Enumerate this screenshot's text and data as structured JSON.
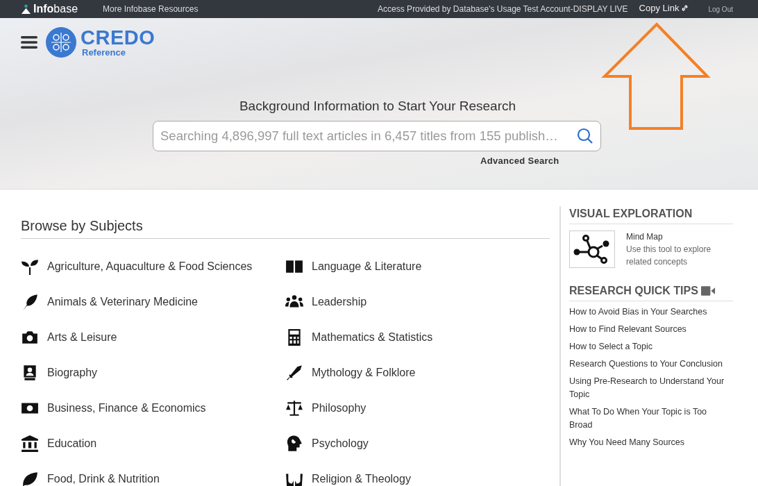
{
  "top_bar": {
    "brand": "**Info**base",
    "resources_link": "More Infobase Resources",
    "access_text": "Access Provided by Database's Usage Test Account-DISPLAY LIVE",
    "copy_link": "Copy Link",
    "logout": "Log Out"
  },
  "header": {
    "logo_title": "CREDO",
    "logo_subtitle": "Reference"
  },
  "hero": {
    "heading": "Background Information to Start Your Research",
    "search": {
      "placeholder": "Searching 4,896,997 full text articles in 6,457 titles from 155 publish…"
    },
    "advanced_search": "Advanced Search"
  },
  "browse": {
    "title": "Browse by Subjects",
    "subjects": [
      {
        "label": "Agriculture, Aquaculture & Food Sciences"
      },
      {
        "label": "Animals & Veterinary Medicine"
      },
      {
        "label": "Arts & Leisure"
      },
      {
        "label": "Biography"
      },
      {
        "label": "Business, Finance & Economics"
      },
      {
        "label": "Education"
      },
      {
        "label": "Food, Drink & Nutrition"
      },
      {
        "label": "Language & Literature"
      },
      {
        "label": "Leadership"
      },
      {
        "label": "Mathematics & Statistics"
      },
      {
        "label": "Mythology & Folklore"
      },
      {
        "label": "Philosophy"
      },
      {
        "label": "Psychology"
      },
      {
        "label": "Religion & Theology"
      }
    ]
  },
  "visual_exploration": {
    "title": "VISUAL EXPLORATION",
    "tool_name": "Mind Map",
    "tool_description": "Use this tool to explore related concepts"
  },
  "quick_tips": {
    "title": "RESEARCH QUICK TIPS",
    "links": [
      "How to Avoid Bias in Your Searches",
      "How to Find Relevant Sources",
      "How to Select a Topic",
      "Research Questions to Your Conclusion",
      "Using Pre-Research to Understand Your Topic",
      "What To Do When Your Topic is Too Broad",
      "Why You Need Many Sources"
    ]
  }
}
